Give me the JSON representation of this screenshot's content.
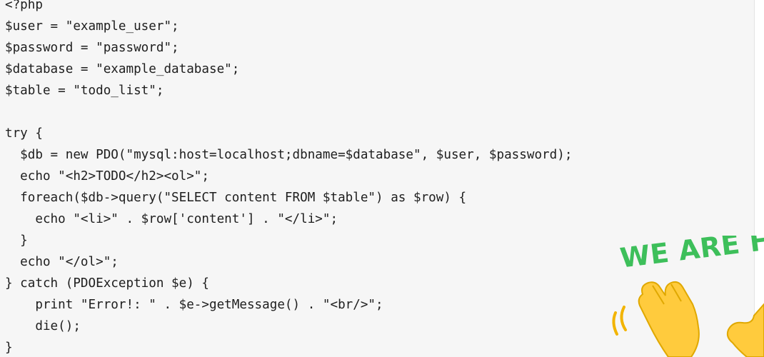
{
  "code": {
    "lines": [
      "<?php",
      "$user = \"example_user\";",
      "$password = \"password\";",
      "$database = \"example_database\";",
      "$table = \"todo_list\";",
      "",
      "try {",
      "  $db = new PDO(\"mysql:host=localhost;dbname=$database\", $user, $password);",
      "  echo \"<h2>TODO</h2><ol>\";",
      "  foreach($db->query(\"SELECT content FROM $table\") as $row) {",
      "    echo \"<li>\" . $row['content'] . \"</li>\";",
      "  }",
      "  echo \"</ol>\";",
      "} catch (PDOException $e) {",
      "    print \"Error!: \" . $e->getMessage() . \"<br/>\";",
      "    die();",
      "}"
    ]
  },
  "badge": {
    "text": "WE ARE H",
    "icon": "waving-hand-icon",
    "color": "#3dbf5a"
  }
}
